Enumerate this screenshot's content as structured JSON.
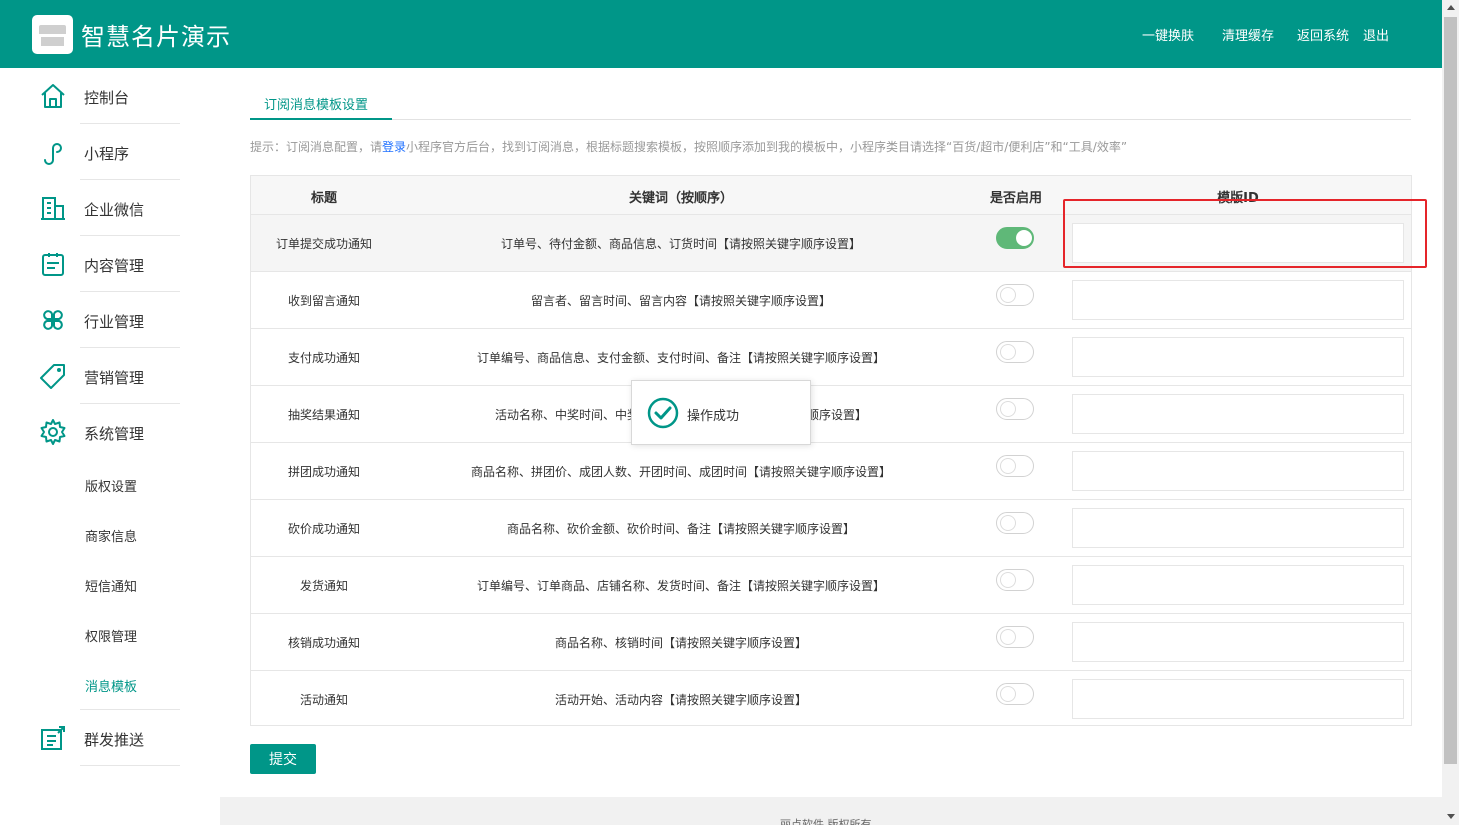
{
  "header": {
    "app_title": "智慧名片演示",
    "links": [
      "一键换肤",
      "清理缓存",
      "返回系统",
      "退出"
    ]
  },
  "sidebar": {
    "items": [
      {
        "label": "控制台",
        "icon": "home-icon"
      },
      {
        "label": "小程序",
        "icon": "mini-program-icon"
      },
      {
        "label": "企业微信",
        "icon": "building-icon"
      },
      {
        "label": "内容管理",
        "icon": "clipboard-icon"
      },
      {
        "label": "行业管理",
        "icon": "clover-icon"
      },
      {
        "label": "营销管理",
        "icon": "tag-icon"
      },
      {
        "label": "系统管理",
        "icon": "gear-icon"
      }
    ],
    "sub_items": [
      "版权设置",
      "商家信息",
      "短信通知",
      "权限管理",
      "消息模板"
    ],
    "active_sub": "消息模板",
    "last_item": {
      "label": "群发推送",
      "icon": "broadcast-icon"
    }
  },
  "main": {
    "tab": "订阅消息模板设置",
    "tip_prefix": "提示：订阅消息配置，请",
    "tip_link": "登录",
    "tip_suffix": "小程序官方后台，找到订阅消息，根据标题搜索模板，按照顺序添加到我的模板中，小程序类目请选择“百货/超市/便利店”和“工具/效率”",
    "columns": [
      "标题",
      "关键词（按顺序）",
      "是否启用",
      "模版ID"
    ],
    "rows": [
      {
        "title": "订单提交成功通知",
        "keywords": "订单号、待付金额、商品信息、订货时间【请按照关键字顺序设置】",
        "enabled": true,
        "template_id": ""
      },
      {
        "title": "收到留言通知",
        "keywords": "留言者、留言时间、留言内容【请按照关键字顺序设置】",
        "enabled": false,
        "template_id": ""
      },
      {
        "title": "支付成功通知",
        "keywords": "订单编号、商品信息、支付金额、支付时间、备注【请按照关键字顺序设置】",
        "enabled": false,
        "template_id": ""
      },
      {
        "title": "抽奖结果通知",
        "keywords": "活动名称、中奖时间、中奖奖品、温馨提示【请按照关键字顺序设置】",
        "enabled": false,
        "template_id": ""
      },
      {
        "title": "拼团成功通知",
        "keywords": "商品名称、拼团价、成团人数、开团时间、成团时间【请按照关键字顺序设置】",
        "enabled": false,
        "template_id": ""
      },
      {
        "title": "砍价成功通知",
        "keywords": "商品名称、砍价金额、砍价时间、备注【请按照关键字顺序设置】",
        "enabled": false,
        "template_id": ""
      },
      {
        "title": "发货通知",
        "keywords": "订单编号、订单商品、店铺名称、发货时间、备注【请按照关键字顺序设置】",
        "enabled": false,
        "template_id": ""
      },
      {
        "title": "核销成功通知",
        "keywords": "商品名称、核销时间【请按照关键字顺序设置】",
        "enabled": false,
        "template_id": ""
      },
      {
        "title": "活动通知",
        "keywords": "活动开始、活动内容【请按照关键字顺序设置】",
        "enabled": false,
        "template_id": ""
      }
    ],
    "submit_label": "提交"
  },
  "toast": {
    "message": "操作成功"
  },
  "footer": {
    "text": "丽点软件 版权所有"
  },
  "colors": {
    "primary": "#009688",
    "toggle_on": "#5fb878",
    "highlight_border": "#e5252a",
    "link": "#1e6fff"
  }
}
